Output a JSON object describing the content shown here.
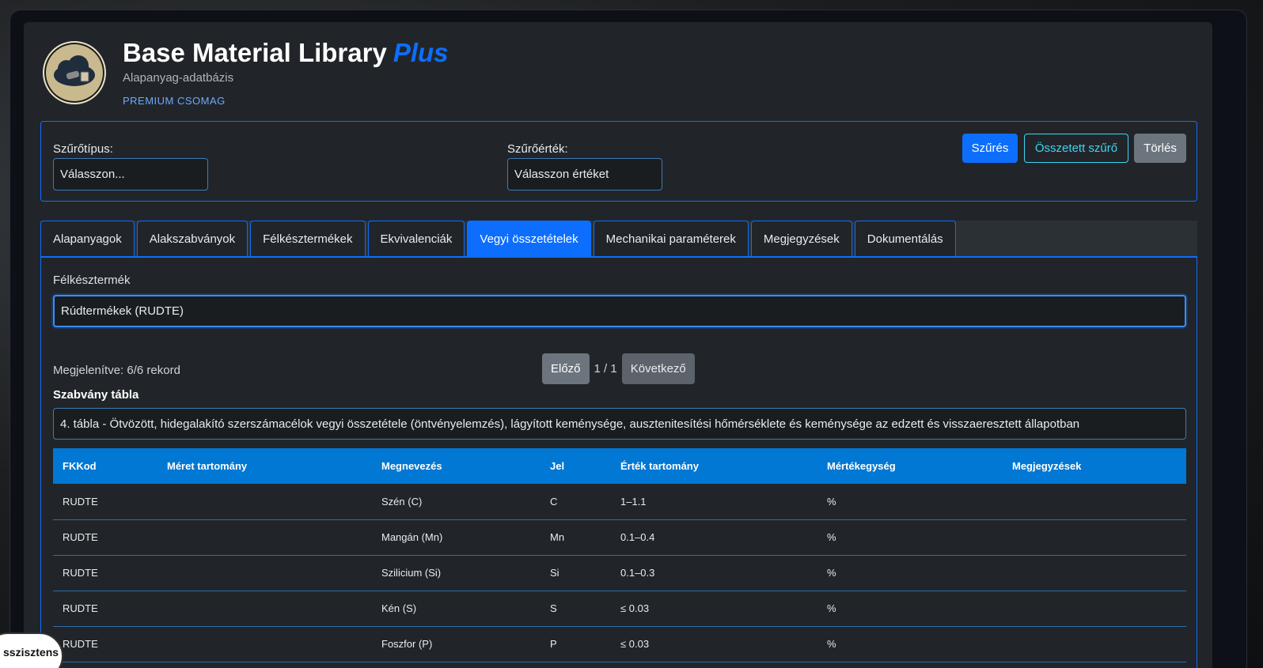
{
  "header": {
    "title": "Base Material Library",
    "title_accent": "Plus",
    "subtitle": "Alapanyag-adatbázis",
    "package": "PREMIUM CSOMAG"
  },
  "filter": {
    "type_label": "Szűrőtípus:",
    "type_value": "Válasszon...",
    "value_label": "Szűrőérték:",
    "value_value": "Válasszon értéket",
    "btn_filter": "Szűrés",
    "btn_complex": "Összetett szűrő",
    "btn_clear": "Törlés"
  },
  "tabs": [
    {
      "label": "Alapanyagok"
    },
    {
      "label": "Alakszabványok"
    },
    {
      "label": "Félkésztermékek"
    },
    {
      "label": "Ekvivalenciák"
    },
    {
      "label": "Vegyi összetételek"
    },
    {
      "label": "Mechanikai paraméterek"
    },
    {
      "label": "Megjegyzések"
    },
    {
      "label": "Dokumentálás"
    }
  ],
  "content": {
    "product_label": "Félkésztermék",
    "product_value": "Rúdtermékek (RUDTE)",
    "records": "Megjelenítve: 6/6 rekord",
    "prev": "Előző",
    "page_info": "1 / 1",
    "next": "Következő",
    "std_label": "Szabvány tábla",
    "std_value": "4. tábla - Ötvözött, hidegalakító szerszámacélok vegyi összetétele (öntvényelemzés), lágyított keménysége, ausztenitesítési hőmérséklete és keménysége az edzett és visszaeresztett állapotban"
  },
  "table": {
    "headers": [
      "FKKod",
      "Méret tartomány",
      "Megnevezés",
      "Jel",
      "Érték tartomány",
      "Mértékegység",
      "Megjegyzések"
    ],
    "rows": [
      [
        "RUDTE",
        "",
        "Szén (C)",
        "C",
        "1–1.1",
        "%",
        ""
      ],
      [
        "RUDTE",
        "",
        "Mangán (Mn)",
        "Mn",
        "0.1–0.4",
        "%",
        ""
      ],
      [
        "RUDTE",
        "",
        "Szilicium (Si)",
        "Si",
        "0.1–0.3",
        "%",
        ""
      ],
      [
        "RUDTE",
        "",
        "Kén (S)",
        "S",
        "≤ 0.03",
        "%",
        ""
      ],
      [
        "RUDTE",
        "",
        "Foszfor (P)",
        "P",
        "≤ 0.03",
        "%",
        ""
      ]
    ]
  },
  "assistant": {
    "label": "sszisztens"
  }
}
